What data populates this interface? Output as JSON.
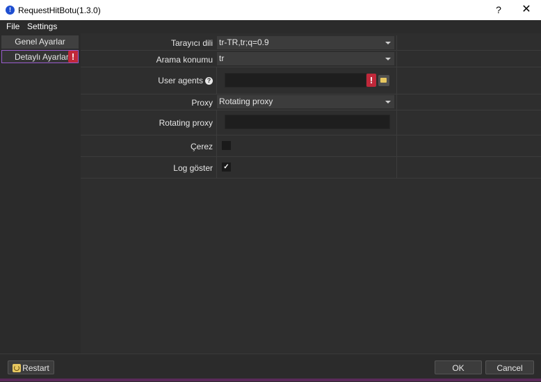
{
  "window": {
    "title": "RequestHitBotu(1.3.0)",
    "help_label": "?",
    "close_label": "✕"
  },
  "menu": {
    "items": [
      "File",
      "Settings"
    ]
  },
  "sidebar": {
    "items": [
      {
        "label": "Genel Ayarlar",
        "active": false
      },
      {
        "label": "Detaylı Ayarlar",
        "active": true,
        "warning": "!"
      }
    ]
  },
  "settings": {
    "browser_language": {
      "label": "Tarayıcı dili",
      "value": "tr-TR,tr;q=0.9"
    },
    "search_location": {
      "label": "Arama konumu",
      "value": "tr"
    },
    "user_agents": {
      "label": "User agents",
      "value": "",
      "help": "?",
      "warning": "!"
    },
    "proxy": {
      "label": "Proxy",
      "value": "Rotating proxy"
    },
    "rotating_proxy": {
      "label": "Rotating proxy",
      "value": ""
    },
    "cookie": {
      "label": "Çerez",
      "checked": false
    },
    "show_log": {
      "label": "Log göster",
      "checked": true,
      "check_mark": "✓"
    }
  },
  "footer": {
    "restart_label": "Restart",
    "ok_label": "OK",
    "cancel_label": "Cancel"
  },
  "colors": {
    "background": "#2b2b2b",
    "warning": "#c0283a",
    "active_border": "#9a5ccf"
  }
}
